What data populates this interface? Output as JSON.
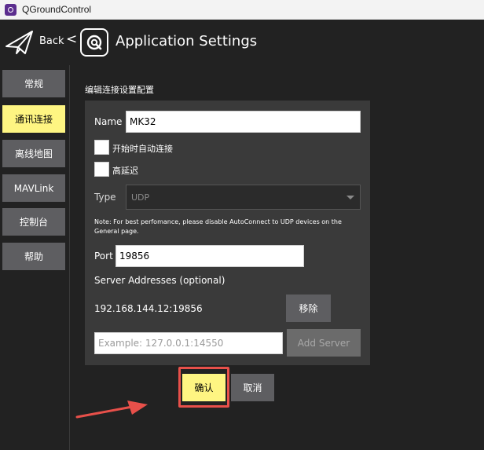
{
  "window": {
    "title": "QGroundControl"
  },
  "header": {
    "back_label": "Back",
    "chevron": "<",
    "page_title": "Application Settings"
  },
  "sidebar": {
    "items": [
      {
        "label": "常规",
        "active": false
      },
      {
        "label": "通讯连接",
        "active": true
      },
      {
        "label": "离线地图",
        "active": false
      },
      {
        "label": "MAVLink",
        "active": false
      },
      {
        "label": "控制台",
        "active": false
      },
      {
        "label": "帮助",
        "active": false
      }
    ]
  },
  "form": {
    "section_title": "编辑连接设置配置",
    "name_label": "Name",
    "name_value": "MK32",
    "auto_connect_label": "开始时自动连接",
    "high_latency_label": "高延迟",
    "type_label": "Type",
    "type_value": "UDP",
    "note_line1": "Note: For best perfomance, please disable AutoConnect to UDP devices on the",
    "note_line2": "General page.",
    "port_label": "Port",
    "port_value": "19856",
    "server_addresses_label": "Server Addresses (optional)",
    "server_address": "192.168.144.12:19856",
    "remove_label": "移除",
    "server_placeholder": "Example: 127.0.0.1:14550",
    "add_server_label": "Add Server"
  },
  "actions": {
    "confirm_label": "确认",
    "cancel_label": "取消"
  },
  "colors": {
    "accent": "#fef582",
    "button": "#5e5e61",
    "highlight": "#e8504a",
    "background": "#222222",
    "panel": "#3a3a3a"
  }
}
